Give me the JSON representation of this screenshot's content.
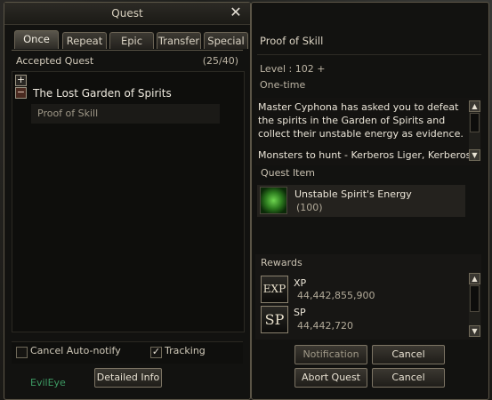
{
  "quest_window": {
    "title": "Quest",
    "tabs": [
      "Once",
      "Repeat",
      "Epic",
      "Transfer",
      "Special"
    ],
    "active_tab": "Once",
    "accepted_label": "Accepted Quest",
    "accepted_count": "(25/40)",
    "group_title": "The Lost Garden of Spirits",
    "sub_item": "Proof of Skill",
    "cancel_autonotify_label": "Cancel Auto-notify",
    "tracking_label": "Tracking",
    "detailed_info_label": "Detailed Info",
    "character_name": "EvilEye"
  },
  "detail_window": {
    "quest_title": "Proof of Skill",
    "level": "Level :  102 +",
    "frequency": "One-time",
    "description": "Master Cyphona has asked you to defeat the spirits in the Garden of Spirits and collect their unstable energy as evidence.",
    "monsters": "Monsters to hunt - Kerberos Liger, Kerberos",
    "quest_item_label": "Quest Item",
    "quest_item": {
      "name": "Unstable Spirit's Energy",
      "qty": "(100)"
    },
    "rewards_label": "Rewards",
    "rewards": [
      {
        "icon": "EXP",
        "name": "XP",
        "value": "44,442,855,900"
      },
      {
        "icon": "SP",
        "name": "SP",
        "value": "44,442,720"
      }
    ],
    "buttons": {
      "notification": "Notification",
      "cancel_top": "Cancel",
      "abort": "Abort Quest",
      "cancel_bottom": "Cancel"
    }
  }
}
